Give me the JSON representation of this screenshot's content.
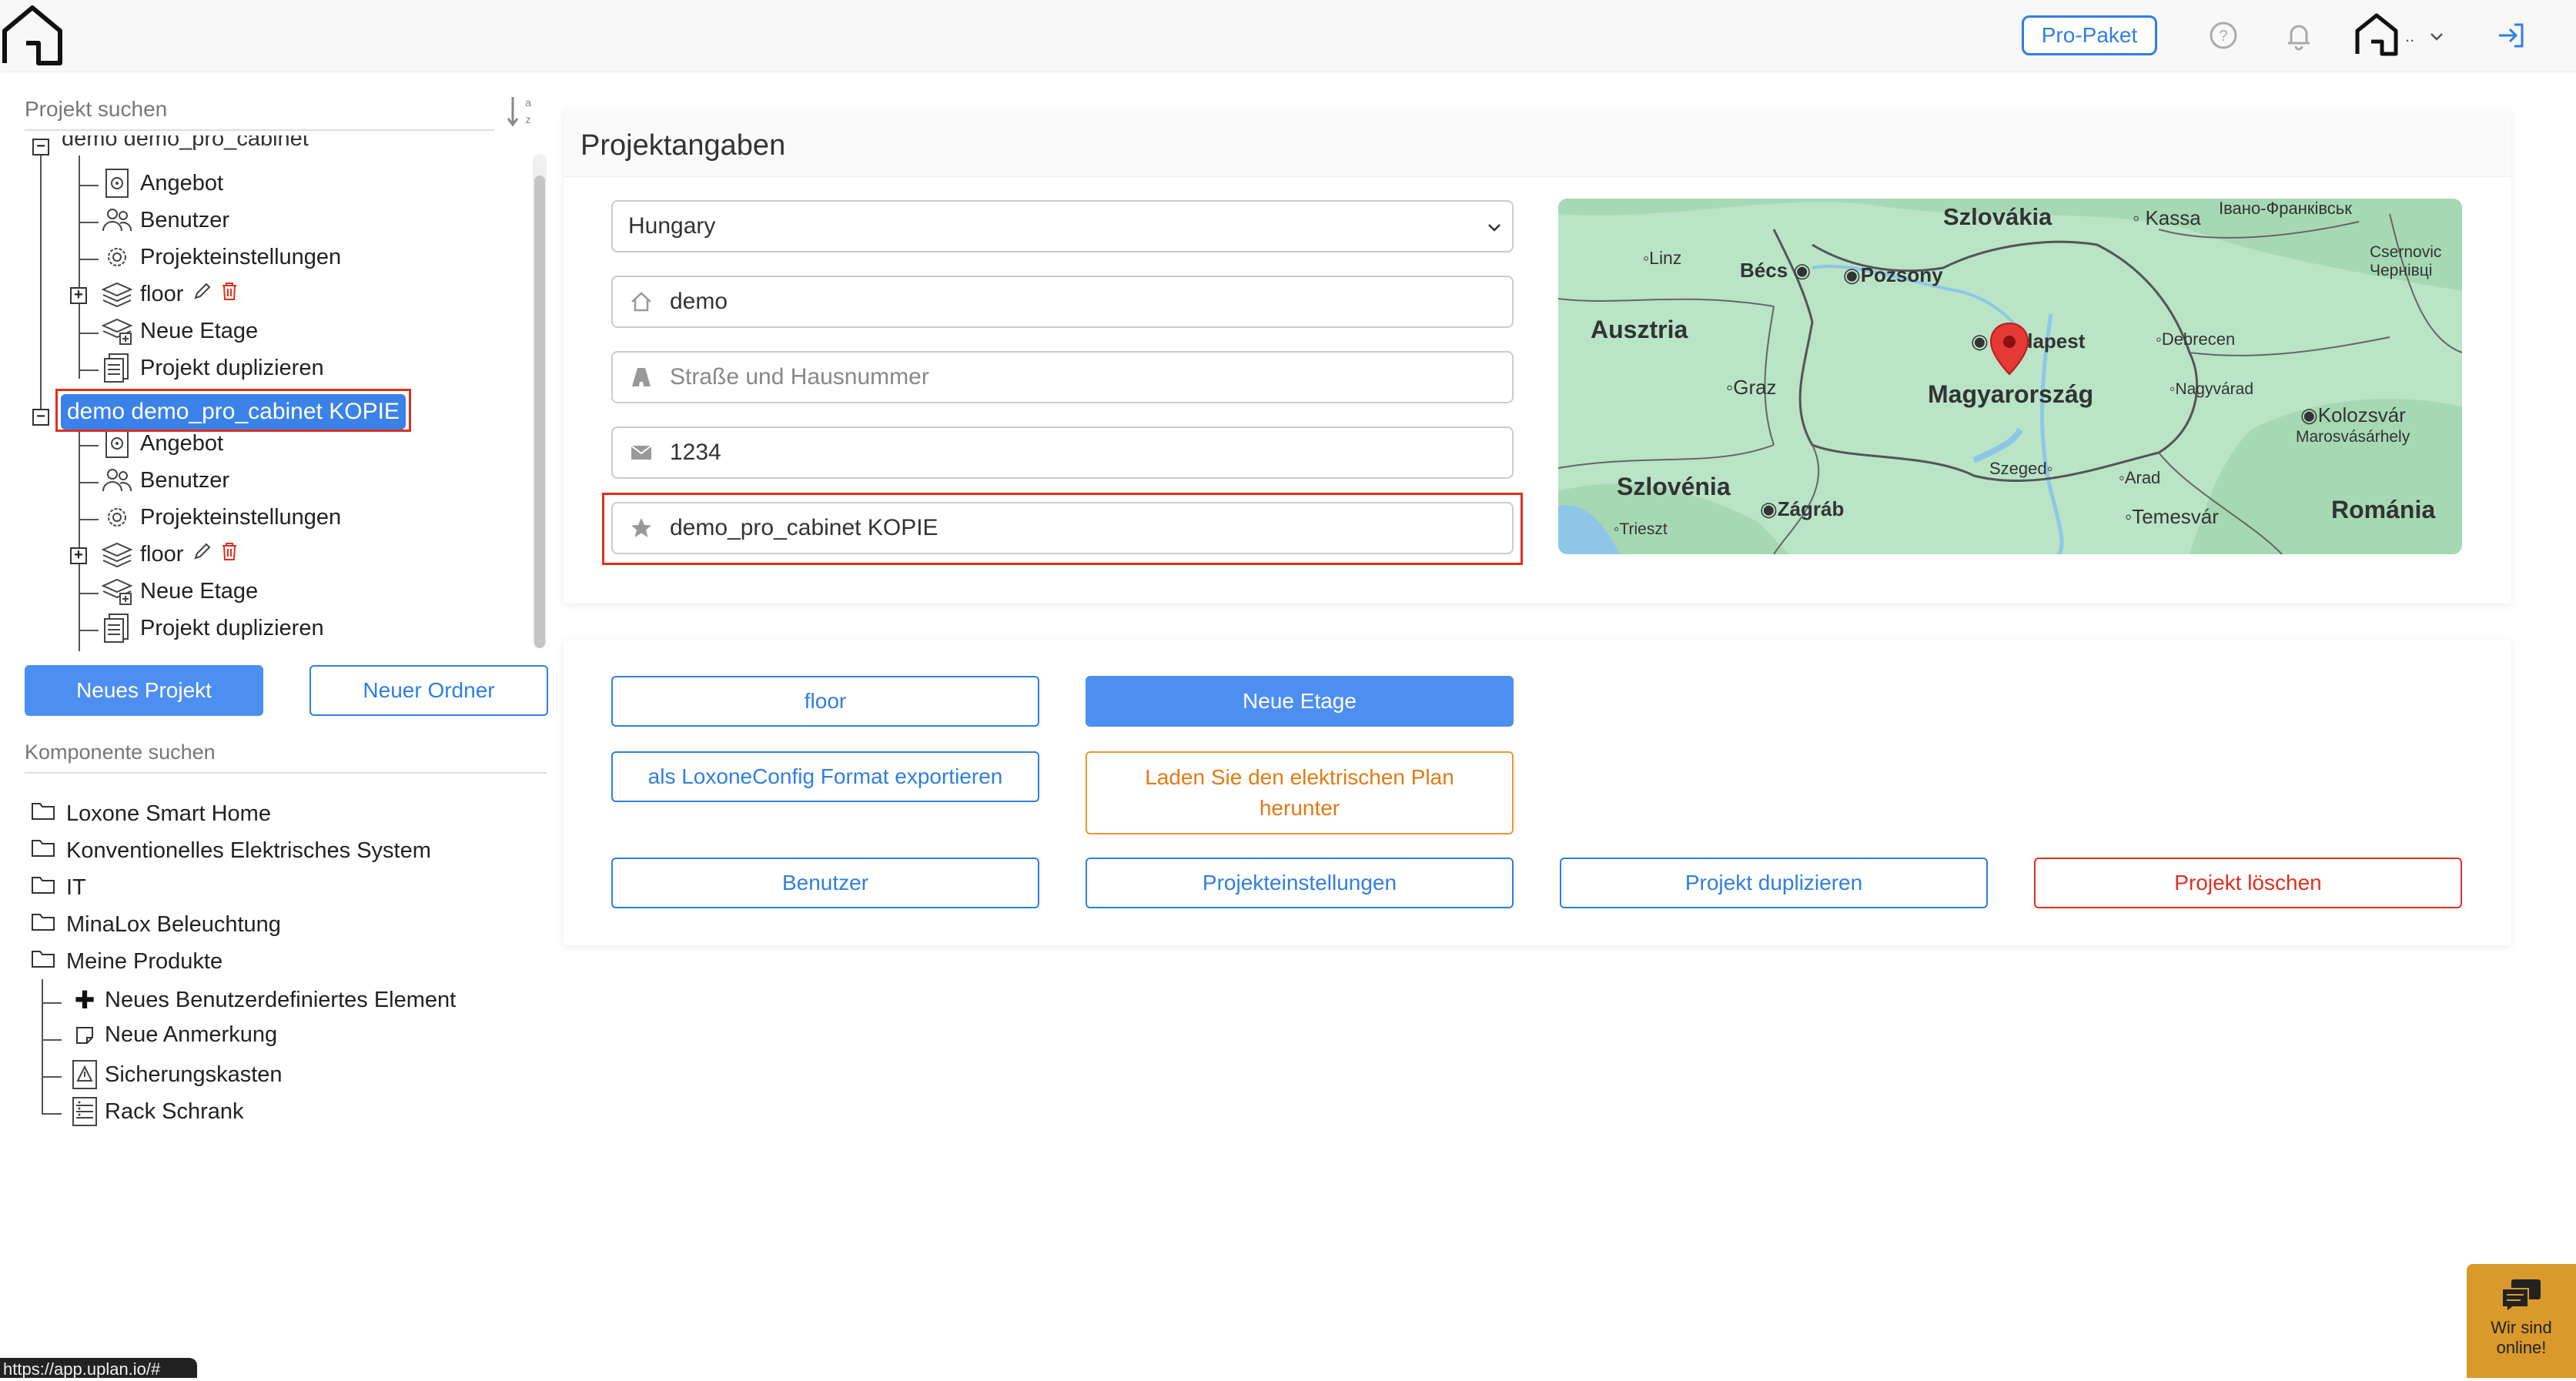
{
  "header": {
    "pro_label": "Pro-Paket",
    "user_menu_dots": ".."
  },
  "sidebar": {
    "project_search_placeholder": "Projekt suchen",
    "sort_label": "a z",
    "tree": {
      "partial_root": "demo demo_pro_cabinet",
      "first_children": [
        "Angebot",
        "Benutzer",
        "Projekteinstellungen",
        "floor",
        "Neue Etage",
        "Projekt duplizieren"
      ],
      "selected_root": "demo demo_pro_cabinet KOPIE",
      "second_children": [
        "Angebot",
        "Benutzer",
        "Projekteinstellungen",
        "floor",
        "Neue Etage",
        "Projekt duplizieren"
      ]
    },
    "new_project_label": "Neues Projekt",
    "new_folder_label": "Neuer Ordner",
    "component_search_placeholder": "Komponente suchen",
    "components": [
      "Loxone Smart Home",
      "Konventionelles Elektrisches System",
      "IT",
      "MinaLox Beleuchtung",
      "Meine Produkte"
    ],
    "my_products": [
      "Neues Benutzerdefiniertes Element",
      "Neue Anmerkung",
      "Sicherungskasten",
      "Rack Schrank"
    ]
  },
  "project_card": {
    "title": "Projektangaben",
    "country_value": "Hungary",
    "city_value": "demo",
    "street_placeholder": "Straße und Hausnummer",
    "zip_value": "1234",
    "name_value": "demo_pro_cabinet KOPIE"
  },
  "map": {
    "labels": {
      "szlovakia": "Szlovákia",
      "kassa": "Kassa",
      "ivano": "Івано-Франківськ",
      "linz": "Linz",
      "becs": "Bécs",
      "pozsony": "Pozsony",
      "csernovic": "Csernovic\nЧернівці",
      "ausztria": "Ausztria",
      "budapest": "Budapest",
      "debrecen": "Debrecen",
      "graz": "Graz",
      "magyarorszag": "Magyarország",
      "nagyvarad": "Nagyvárad",
      "kolozsvar": "Kolozsvár",
      "marosvasarhely": "Marosvásárhely",
      "szeged": "Szeged",
      "arad": "Arad",
      "szlovenia": "Szlovénia",
      "zagrab": "Zágráb",
      "trieszt": "Trieszt",
      "temesvar": "Temesvár",
      "romania": "Románia"
    }
  },
  "actions": {
    "floor_label": "floor",
    "new_floor_label": "Neue Etage",
    "export_label": "als LoxoneConfig Format exportieren",
    "download_plan_label": "Laden Sie den elektrischen Plan herunter",
    "users_label": "Benutzer",
    "settings_label": "Projekteinstellungen",
    "duplicate_label": "Projekt duplizieren",
    "delete_label": "Projekt löschen"
  },
  "status_url": "https://app.uplan.io/#",
  "chat": {
    "line1": "Wir sind",
    "line2": "online!"
  },
  "colors": {
    "primary": "#4d8ff0",
    "accent_blue": "#2f7fe0",
    "danger": "#e0301e",
    "orange": "#e37a12"
  }
}
